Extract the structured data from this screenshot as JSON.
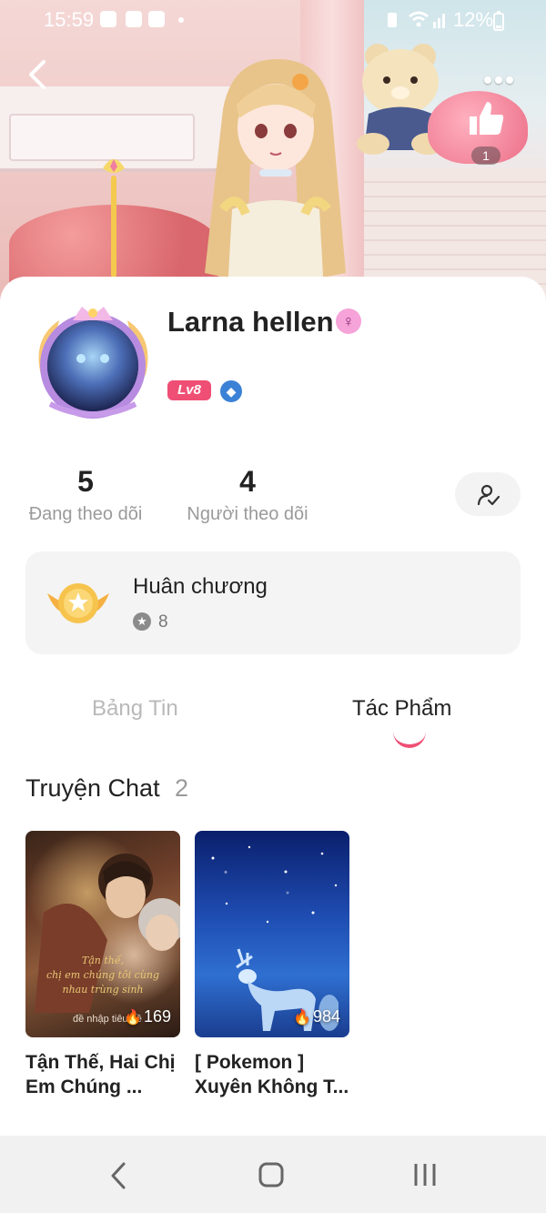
{
  "status_bar": {
    "time": "15:59",
    "battery": "12%"
  },
  "header": {
    "like_count": "1"
  },
  "profile": {
    "username": "Larna hellen",
    "level": "Lv8",
    "stats": {
      "following_count": "5",
      "following_label": "Đang theo dõi",
      "followers_count": "4",
      "followers_label": "Người theo dõi"
    }
  },
  "medals": {
    "title": "Huân chương",
    "count": "8"
  },
  "tabs": {
    "feed": "Bảng Tin",
    "works": "Tác Phẩm",
    "active": "works"
  },
  "works": {
    "section_title": "Truyện Chat",
    "section_count": "2",
    "items": [
      {
        "title": "Tận Thế, Hai Chị Em Chúng ...",
        "views": "169",
        "cover_text_1": "Tận thế,",
        "cover_text_2": "chị em chúng tôi cùng nhau trùng sinh",
        "cover_text_3": "đề nhập tiêu đề"
      },
      {
        "title": "[ Pokemon ] Xuyên Không T...",
        "views": "984"
      }
    ]
  },
  "colors": {
    "accent": "#ef4f74",
    "muted_text": "#9a9a9a",
    "card_bg": "#f4f4f4"
  },
  "icons": {
    "back": "back-arrow-icon",
    "more": "more-dots-icon",
    "like": "thumbs-up-icon",
    "gender": "female-icon",
    "rank": "rank-badge-icon",
    "verify": "user-check-icon",
    "medal": "medal-icon",
    "flame": "flame-icon"
  }
}
